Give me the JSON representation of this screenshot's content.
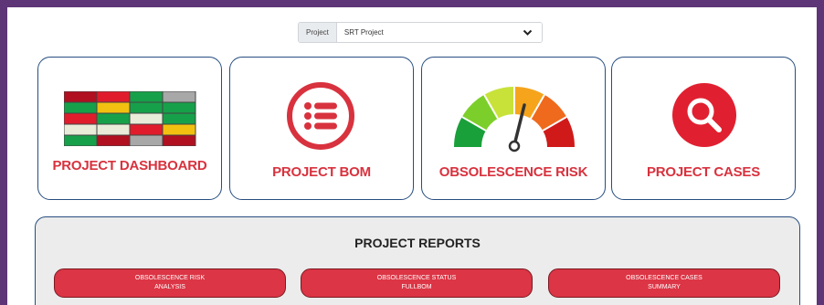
{
  "selector": {
    "label": "Project",
    "value": "SRT Project"
  },
  "tiles": [
    {
      "title": "PROJECT DASHBOARD",
      "icon": "grid-status-icon"
    },
    {
      "title": "PROJECT BOM",
      "icon": "list-icon"
    },
    {
      "title": "OBSOLESCENCE RISK",
      "icon": "gauge-icon"
    },
    {
      "title": "PROJECT CASES",
      "icon": "search-icon"
    }
  ],
  "reports": {
    "title": "PROJECT REPORTS",
    "buttons": [
      {
        "line1": "OBSOLESCENCE RISK",
        "line2": "ANALYSIS"
      },
      {
        "line1": "OBSOLESCENCE STATUS",
        "line2": "FULLBOM"
      },
      {
        "line1": "OBSOLESCENCE CASES",
        "line2": "SUMMARY"
      }
    ]
  },
  "colors": {
    "background": "#5e3576",
    "accent_red": "#d8323e",
    "button_red": "#dc3545",
    "border_blue": "#274d80",
    "reports_bg": "#ececec"
  }
}
